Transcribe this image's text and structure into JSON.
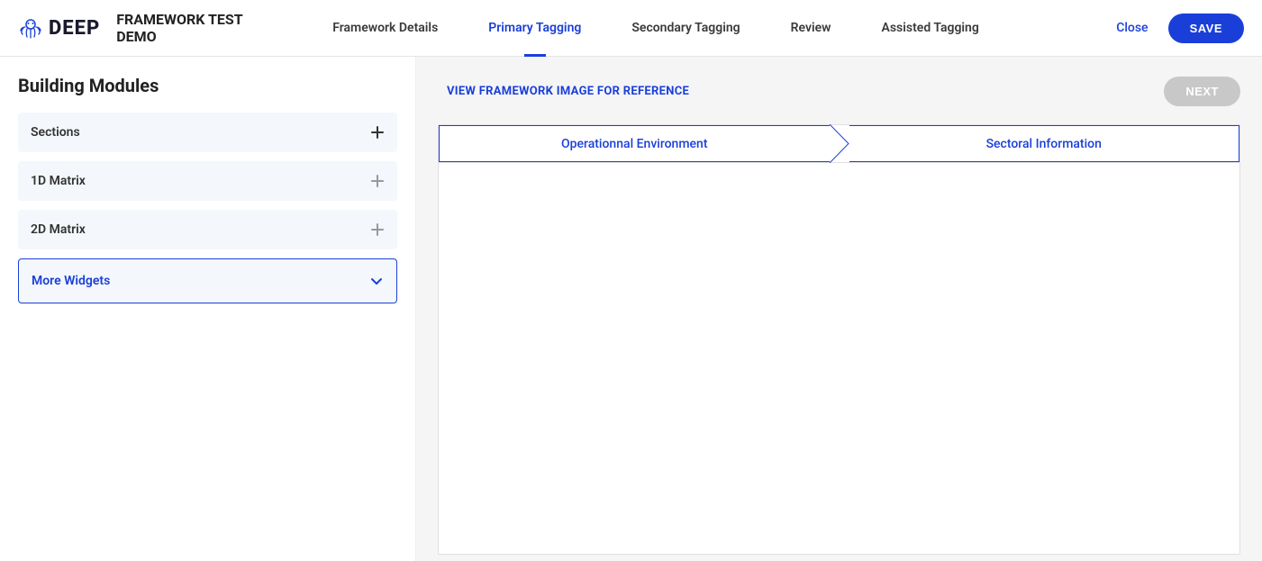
{
  "header": {
    "logo_text": "DEEP",
    "project_title": "FRAMEWORK TEST DEMO",
    "tabs": [
      {
        "label": "Framework Details",
        "active": false
      },
      {
        "label": "Primary Tagging",
        "active": true
      },
      {
        "label": "Secondary Tagging",
        "active": false
      },
      {
        "label": "Review",
        "active": false
      },
      {
        "label": "Assisted Tagging",
        "active": false
      }
    ],
    "close_label": "Close",
    "save_label": "SAVE"
  },
  "sidebar": {
    "title": "Building Modules",
    "modules": [
      {
        "label": "Sections",
        "icon": "plus",
        "selected": false,
        "muted": false
      },
      {
        "label": "1D Matrix",
        "icon": "plus",
        "selected": false,
        "muted": true
      },
      {
        "label": "2D Matrix",
        "icon": "plus",
        "selected": false,
        "muted": true
      },
      {
        "label": "More Widgets",
        "icon": "chevron-down",
        "selected": true,
        "muted": false
      }
    ]
  },
  "content": {
    "view_link": "VIEW FRAMEWORK IMAGE FOR REFERENCE",
    "next_label": "NEXT",
    "steps": [
      {
        "label": "Operationnal Environment"
      },
      {
        "label": "Sectoral Information"
      }
    ]
  }
}
